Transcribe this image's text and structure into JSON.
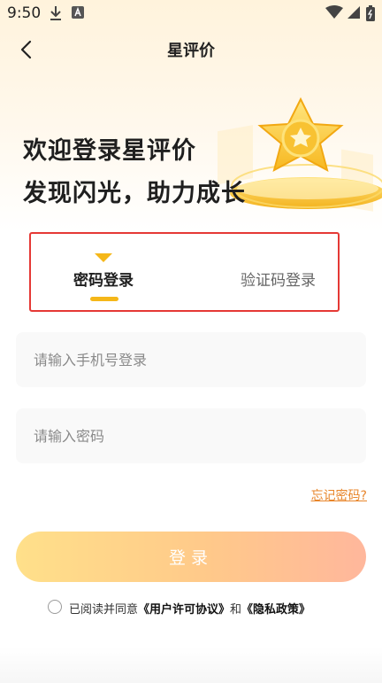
{
  "status_bar": {
    "time": "9:50"
  },
  "header": {
    "title": "星评价"
  },
  "welcome": {
    "line1": "欢迎登录星评价",
    "line2": "发现闪光，助力成长"
  },
  "tabs": [
    {
      "label": "密码登录",
      "active": true
    },
    {
      "label": "验证码登录",
      "active": false
    }
  ],
  "form": {
    "phone_placeholder": "请输入手机号登录",
    "password_placeholder": "请输入密码",
    "forgot_label": "忘记密码?",
    "login_label": "登录"
  },
  "agreement": {
    "prefix": "已阅读并同意",
    "user_agreement": "《用户许可协议》",
    "conjunction": "和",
    "privacy_policy": "《隐私政策》",
    "checked": false
  },
  "colors": {
    "accent": "#f5b719",
    "link": "#e8852a",
    "highlight_border": "#e53935"
  }
}
